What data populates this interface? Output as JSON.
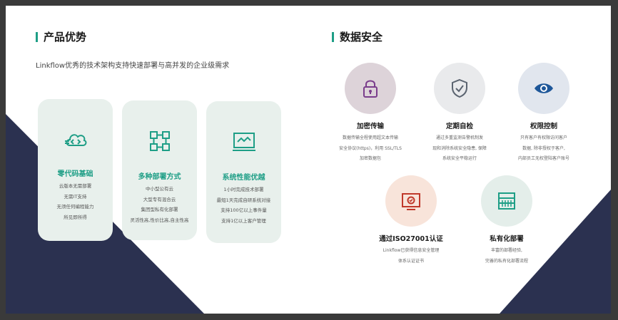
{
  "left_section": {
    "title": "产品优势",
    "subtitle": "Linkflow优秀的技术架构支持快速部署与高并发的企业级需求",
    "cards": [
      {
        "icon": "code-cloud-icon",
        "title": "零代码基础",
        "lines": [
          "云版本无需部署",
          "无需IT支持",
          "无须任何编程能力",
          "所见即所得"
        ]
      },
      {
        "icon": "deployment-nodes-icon",
        "title": "多种部署方式",
        "lines": [
          "中小型公有云",
          "大型专有混合云",
          "集团型私有化部署",
          "灵活性高,性价比高,自主性高"
        ]
      },
      {
        "icon": "monitor-chart-icon",
        "title": "系统性能优越",
        "lines": [
          "1小时完成技术部署",
          "最短1天完成自研系统对接",
          "支持100亿以上事件量",
          "支持1亿以上客户管理"
        ]
      }
    ]
  },
  "right_section": {
    "title": "数据安全",
    "features": [
      {
        "icon": "lock-icon",
        "title": "加密传输",
        "lines": [
          "数据传输全程使用超文本传输",
          "安全协议(https)，利用 SSL/TLS",
          "加密数据包"
        ]
      },
      {
        "icon": "shield-check-icon",
        "title": "定期自检",
        "lines": [
          "通过多重监测告警机制发",
          "现和消除系统安全隐患, 保障",
          "系统安全平稳运行"
        ]
      },
      {
        "icon": "eye-icon",
        "title": "权限控制",
        "lines": [
          "只有客户有权限访问客户",
          "数据, 除非授权于客户,",
          "内部员工无权登陆客户账号"
        ]
      },
      {
        "icon": "certificate-icon",
        "title": "通过ISO27001认证",
        "lines": [
          "Linkflow已获得信息安全管理",
          "体系认证证书"
        ]
      },
      {
        "icon": "server-icon",
        "title": "私有化部署",
        "lines": [
          "丰富的部署经验,",
          "完善的私有化部署流程"
        ]
      }
    ]
  },
  "colors": {
    "accent": "#1e9e86",
    "navy": "#2b3150",
    "card_bg": "#e8f0ec"
  }
}
